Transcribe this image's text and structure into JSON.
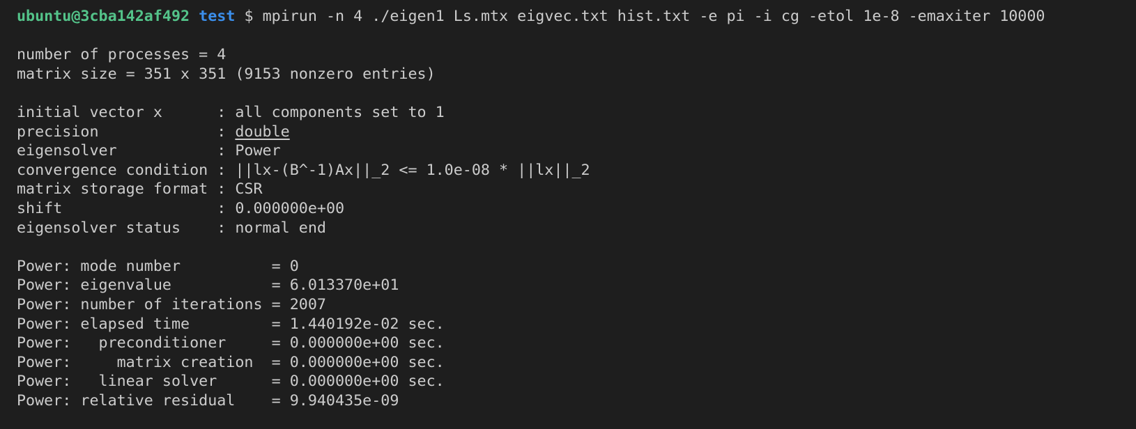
{
  "prompt": {
    "user_host": "ubuntu@3cba142af492",
    "cwd": "test",
    "symbol": "$",
    "command": "mpirun -n 4 ./eigen1 Ls.mtx eigvec.txt hist.txt -e pi -i cg -etol 1e-8 -emaxiter 10000"
  },
  "summary": {
    "processes": "number of processes = 4",
    "matrix_size": "matrix size = 351 x 351 (9153 nonzero entries)"
  },
  "settings": [
    {
      "key": "initial vector x      : ",
      "value": "all components set to 1",
      "underline": false
    },
    {
      "key": "precision             : ",
      "value": "double",
      "underline": true
    },
    {
      "key": "eigensolver           : ",
      "value": "Power",
      "underline": false
    },
    {
      "key": "convergence condition : ",
      "value": "||lx-(B^-1)Ax||_2 <= 1.0e-08 * ||lx||_2",
      "underline": false
    },
    {
      "key": "matrix storage format : ",
      "value": "CSR",
      "underline": false
    },
    {
      "key": "shift                 : ",
      "value": "0.000000e+00",
      "underline": false
    },
    {
      "key": "eigensolver status    : ",
      "value": "normal end",
      "underline": false
    }
  ],
  "results": [
    "Power: mode number          = 0",
    "Power: eigenvalue           = 6.013370e+01",
    "Power: number of iterations = 2007",
    "Power: elapsed time         = 1.440192e-02 sec.",
    "Power:   preconditioner     = 0.000000e+00 sec.",
    "Power:     matrix creation  = 0.000000e+00 sec.",
    "Power:   linear solver      = 0.000000e+00 sec.",
    "Power: relative residual    = 9.940435e-09"
  ]
}
